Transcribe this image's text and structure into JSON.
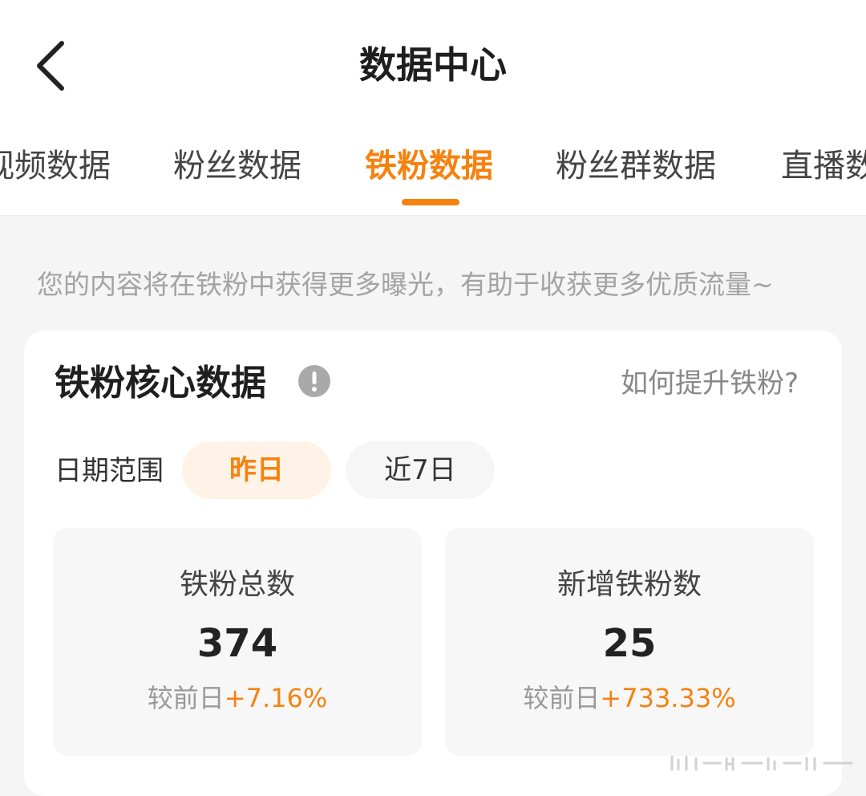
{
  "header": {
    "title": "数据中心",
    "back_icon": "chevron-left-icon"
  },
  "tabs": [
    {
      "label": "视频数据",
      "active": false
    },
    {
      "label": "粉丝数据",
      "active": false
    },
    {
      "label": "铁粉数据",
      "active": true
    },
    {
      "label": "粉丝群数据",
      "active": false
    },
    {
      "label": "直播数据",
      "active": false
    }
  ],
  "hint": "您的内容将在铁粉中获得更多曝光，有助于收获更多优质流量~",
  "card": {
    "title": "铁粉核心数据",
    "info_icon": "info-icon",
    "help_link": "如何提升铁粉?",
    "date_range_label": "日期范围",
    "date_options": [
      {
        "label": "昨日",
        "selected": true
      },
      {
        "label": "近7日",
        "selected": false
      }
    ],
    "stats": [
      {
        "label": "铁粉总数",
        "value": "374",
        "compare_label": "较前日",
        "change": "+7.16%"
      },
      {
        "label": "新增铁粉数",
        "value": "25",
        "compare_label": "较前日",
        "change": "+733.33%"
      }
    ]
  },
  "colors": {
    "accent": "#f5820f",
    "accent_bg": "#fff2e6",
    "page_bg": "#f5f5f5",
    "muted_text": "#a3a3a3"
  }
}
